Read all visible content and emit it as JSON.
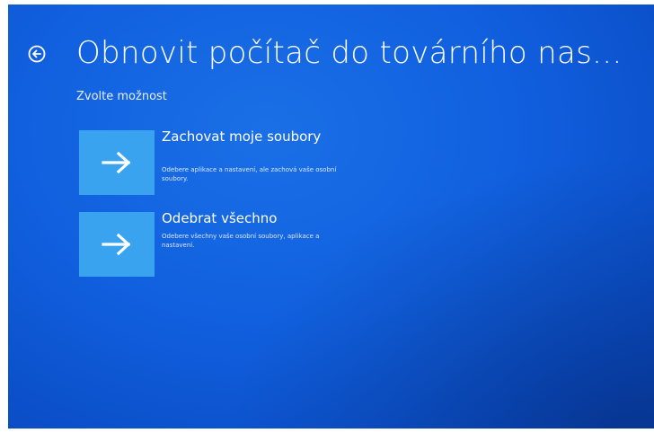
{
  "header": {
    "title": "Obnovit počítač do továrního nas...",
    "subtitle": "Zvolte možnost"
  },
  "options": [
    {
      "title": "Zachovat moje soubory",
      "description": "Odebere aplikace a nastavení, ale zachová vaše osobní soubory.",
      "icon": "arrow-right-icon"
    },
    {
      "title": "Odebrat všechno",
      "description": "Odebere všechny vaše osobní soubory, aplikace a nastavení.",
      "icon": "arrow-right-icon"
    }
  ],
  "colors": {
    "background": "#1160df",
    "tile": "#3aa3ef",
    "text": "#ffffff"
  }
}
